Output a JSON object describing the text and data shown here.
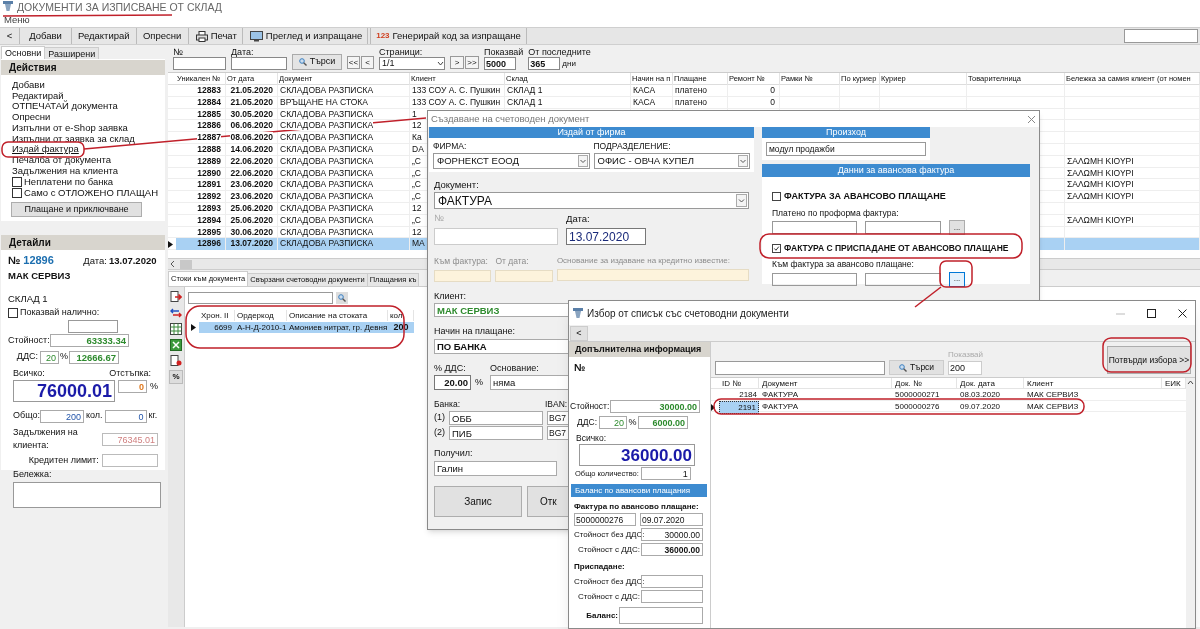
{
  "window": {
    "title": "ДОКУМЕНТИ ЗА ИЗПИСВАНЕ ОТ СКЛАД",
    "menu": "Меню"
  },
  "toolbar": [
    {
      "label": "<",
      "kind": "plain"
    },
    {
      "label": "Добави",
      "kind": "plain"
    },
    {
      "label": "Редактирай",
      "kind": "plain"
    },
    {
      "label": "Опресни",
      "kind": "plain"
    },
    {
      "label": "Печат",
      "kind": "print"
    },
    {
      "label": "Преглед и изпращане",
      "kind": "preview"
    },
    {
      "label": "Генерирай код за изпращане",
      "kind": "code",
      "icon_text": "123"
    }
  ],
  "sidebar": {
    "tabs": [
      {
        "label": "Основни",
        "selected": true
      },
      {
        "label": "Разширени",
        "selected": false
      }
    ],
    "actions_title": "Действия",
    "actions": [
      {
        "label": "Добави",
        "kind": "link",
        "hovered": false
      },
      {
        "label": "Редактирай",
        "kind": "link",
        "hovered": false
      },
      {
        "label": "ОТПЕЧАТАЙ документа",
        "kind": "link",
        "hovered": false
      },
      {
        "label": "Опресни",
        "kind": "link",
        "hovered": false
      },
      {
        "label": "Изпълни от e-Shop заявка",
        "kind": "link",
        "hovered": false
      },
      {
        "label": "Изпълни от заявка за склад",
        "kind": "link",
        "hovered": false
      },
      {
        "label": "Издай фактура",
        "kind": "link",
        "hovered": true
      },
      {
        "label": "Печалба от документа",
        "kind": "link",
        "hovered": false
      },
      {
        "label": "Задължения на клиента",
        "kind": "link",
        "hovered": false
      },
      {
        "label": "Неплатени по банка",
        "kind": "checkbox",
        "checked": false
      },
      {
        "label": "Само с ОТЛОЖЕНО ПЛАЩАН",
        "kind": "checkbox",
        "checked": false
      },
      {
        "label": "Плащане и приключване",
        "kind": "button"
      }
    ]
  },
  "details": {
    "title": "Детайли",
    "number_label": "№",
    "number": "12896",
    "date_label": "Дата:",
    "date": "13.07.2020",
    "client": "МАК СЕРВИЗ",
    "warehouse": "СКЛАД 1",
    "show_available_label": "Показвай налично:",
    "show_available": false,
    "value_label": "Стойност:",
    "value": "63333.34",
    "vat_label": "ДДС:",
    "vat_rate": "20",
    "percent": "%",
    "vat": "12666.67",
    "total_label": "Всичко:",
    "discount_label": "Отстъпка:",
    "total": "76000.01",
    "discount": "0",
    "discount_unit": "%",
    "sum_label": "Общо:",
    "quantity": "200",
    "quantity_unit": "кол.",
    "weight": "0",
    "weight_unit": "кг.",
    "debt_label": "Задължения на клиента:",
    "debt": "76345.01",
    "credit_label": "Кредитен лимит:",
    "note_label": "Бележка:"
  },
  "filters": {
    "number_label": "№",
    "date_label": "Дата:",
    "search_button": "Търси",
    "pages_label": "Страници:",
    "pages": "1/1",
    "nav_back": [
      "<<",
      "<"
    ],
    "nav_forward": [
      ">",
      ">>"
    ],
    "show_label": "Показвай",
    "show": "5000",
    "last_label": "От последните",
    "last": "365",
    "days": "дни"
  },
  "table": {
    "columns": [
      "Уникален №",
      "От дата",
      "Документ",
      "Клиент",
      "Склад",
      "Начин на п",
      "Плащане",
      "Ремонт №",
      "Рамки №",
      "По куриер",
      "Куриер",
      "Товарителница",
      "Бележка за самия клиент (от номен"
    ],
    "rows": [
      {
        "id": "12883",
        "date": "21.05.2020",
        "document": "СКЛАДОВА РАЗПИСКА",
        "client": "133 СОУ А. С. Пушкин",
        "warehouse": "СКЛАД 1",
        "method": "КАСА",
        "payment": "платено",
        "repair": "0",
        "selected": false
      },
      {
        "id": "12884",
        "date": "21.05.2020",
        "document": "ВРЪЩАНЕ НА СТОКА",
        "client": "133 СОУ А. С. Пушкин",
        "warehouse": "СКЛАД 1",
        "method": "КАСА",
        "payment": "платено",
        "repair": "0",
        "selected": false
      },
      {
        "id": "12885",
        "date": "30.05.2020",
        "document": "СКЛАДОВА РАЗПИСКА",
        "client": "1",
        "selected": false
      },
      {
        "id": "12886",
        "date": "06.06.2020",
        "document": "СКЛАДОВА РАЗПИСКА",
        "client": "12",
        "selected": false
      },
      {
        "id": "12887",
        "date": "08.06.2020",
        "document": "СКЛАДОВА РАЗПИСКА",
        "client": "Ка",
        "selected": false
      },
      {
        "id": "12888",
        "date": "14.06.2020",
        "document": "СКЛАДОВА РАЗПИСКА",
        "client": "DA",
        "selected": false
      },
      {
        "id": "12889",
        "date": "22.06.2020",
        "document": "СКЛАДОВА РАЗПИСКА",
        "client": "„С",
        "note": "ΣΑΛΩΜΗ ΚΙΟΥΡΙ",
        "selected": false
      },
      {
        "id": "12890",
        "date": "22.06.2020",
        "document": "СКЛАДОВА РАЗПИСКА",
        "client": "„С",
        "note": "ΣΑΛΩΜΗ ΚΙΟΥΡΙ",
        "selected": false
      },
      {
        "id": "12891",
        "date": "23.06.2020",
        "document": "СКЛАДОВА РАЗПИСКА",
        "client": "„С",
        "note": "ΣΑΛΩΜΗ ΚΙΟΥΡΙ",
        "selected": false
      },
      {
        "id": "12892",
        "date": "23.06.2020",
        "document": "СКЛАДОВА РАЗПИСКА",
        "client": "„С",
        "note": "ΣΑΛΩΜΗ ΚΙΟΥΡΙ",
        "selected": false
      },
      {
        "id": "12893",
        "date": "25.06.2020",
        "document": "СКЛАДОВА РАЗПИСКА",
        "client": "12",
        "selected": false
      },
      {
        "id": "12894",
        "date": "25.06.2020",
        "document": "СКЛАДОВА РАЗПИСКА",
        "client": "„С",
        "note": "ΣΑΛΩΜΗ ΚΙΟΥΡΙ",
        "selected": false
      },
      {
        "id": "12895",
        "date": "30.06.2020",
        "document": "СКЛАДОВА РАЗПИСКА",
        "client": "12",
        "selected": false
      },
      {
        "id": "12896",
        "date": "13.07.2020",
        "document": "СКЛАДОВА РАЗПИСКА",
        "client": "МА",
        "selected": true
      }
    ]
  },
  "bottom_tabs": [
    {
      "label": "Стоки към документа",
      "selected": true
    },
    {
      "label": "Свързани счетоводни документи",
      "selected": false
    },
    {
      "label": "Плащания къ",
      "selected": false
    }
  ],
  "items": {
    "percent_button": "%",
    "columns": [
      "Хрон. II",
      "Ордеркод",
      "Описание на стоката",
      "кол."
    ],
    "rows": [
      {
        "number": "6699",
        "code": "А-Н-Д-2010-1",
        "description": "Амониев нитрат, гр. Девня",
        "quantity": "200",
        "selected": true
      }
    ]
  },
  "dialog": {
    "title": "Създаване на счетоводен документ",
    "company_header": "Издай от фирма",
    "company_label": "ФИРМА:",
    "company": "ФОРНЕКСТ ЕООД",
    "division_label": "ПОДРАЗДЕЛЕНИЕ:",
    "division": "ОФИС - ОВЧА КУПЕЛ",
    "document_label": "Документ:",
    "document": "ФАКТУРА",
    "number_label": "№",
    "date_label": "Дата:",
    "date": "13.07.2020",
    "to_invoice_label": "Към фактура:",
    "from_date_label": "От дата:",
    "credit_reason_label": "Основание за издаване на кредитно известие:",
    "client_label": "Клиент:",
    "client": "МАК СЕРВИЗ",
    "payment_label": "Начин на плащане:",
    "payment": "ПО БАНКА",
    "vat_label": "% ДДС:",
    "vat": "20.00",
    "vat_unit": "%",
    "basis_label": "Основание:",
    "basis": "няма",
    "bank_label": "Банка:",
    "iban_label": "IBAN:",
    "banks": [
      {
        "index": "(1)",
        "name": "ОББ",
        "iban": "BG7"
      },
      {
        "index": "(2)",
        "name": "ПИБ",
        "iban": "BG7"
      }
    ],
    "received_label": "Получил:",
    "received": "Галин",
    "save_button": "Запис",
    "cancel_button": "Отк",
    "origin_header": "Произход",
    "origin": "модул продажби",
    "advance_header": "Данни за авансова фактура",
    "advance_invoice": {
      "label": "ФАКТУРА ЗА АВАНСОВО ПЛАЩАНЕ",
      "checked": false
    },
    "proforma_label": "Платено по проформа фактура:",
    "browse_button": "...",
    "deduct_invoice": {
      "label": "ФАКТУРА С ПРИСПАДАНЕ ОТ АВАНСОВО ПЛАЩАНЕ",
      "checked": true
    },
    "to_advance_label": "Към фактура за авансово плащане:",
    "browse_button_2": "..."
  },
  "picker": {
    "title": "Избор от списък със счетоводни документи",
    "back_button": "<",
    "info_header": "Допълнителна информация",
    "number_label": "№",
    "value_label": "Стойност:",
    "value": "30000.00",
    "vat_label": "ДДС:",
    "vat_rate": "20",
    "percent": "%",
    "vat": "6000.00",
    "total_label": "Всичко:",
    "total": "36000.00",
    "quantity_label": "Общо количество:",
    "quantity": "1",
    "balance_button": "Баланс по авансови плащания",
    "advance_label": "Фактура по авансово плащане:",
    "advance_number": "5000000276",
    "advance_date": "09.07.2020",
    "net_label": "Стойност без ДДС:",
    "net": "30000.00",
    "gross_label": "Стойност с ДДС:",
    "gross": "36000.00",
    "deduction_label": "Приспадане:",
    "deduction_net_label": "Стойност без ДДС:",
    "deduction_gross_label": "Стойност с ДДС:",
    "balance_label": "Баланс:",
    "search_button": "Търси",
    "show_label": "Показвай",
    "show": "200",
    "confirm_button": "Потвърди избора >>",
    "columns": [
      "ID №",
      "Документ",
      "Док. №",
      "Док. дата",
      "Клиент",
      "ЕИК"
    ],
    "rows": [
      {
        "id": "2184",
        "document": "ФАКТУРА",
        "number": "5000000271",
        "date": "08.03.2020",
        "client": "МАК СЕРВИЗ",
        "selected": false
      },
      {
        "id": "2191",
        "document": "ФАКТУРА",
        "number": "5000000276",
        "date": "09.07.2020",
        "client": "МАК СЕРВИЗ",
        "selected": true
      }
    ]
  }
}
